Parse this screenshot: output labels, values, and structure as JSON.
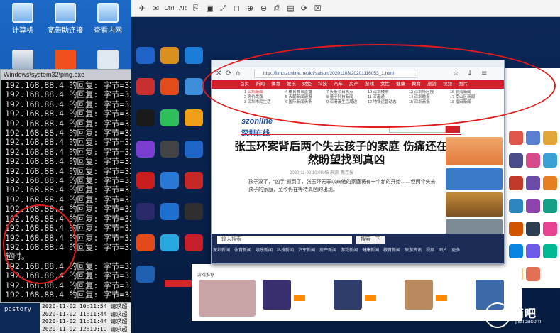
{
  "desktop_left": {
    "icons": [
      {
        "label": "计算机",
        "icon": "computer-icon"
      },
      {
        "label": "宽带助连接",
        "icon": "network-icon"
      },
      {
        "label": "查看内网",
        "icon": "monitor-icon"
      },
      {
        "label": "",
        "icon": "recycle-bin-icon"
      },
      {
        "label": "",
        "icon": "settings-gear-icon"
      },
      {
        "label": "",
        "icon": "document-icon"
      }
    ]
  },
  "cmd": {
    "title": "Windows\\system32\\ping.exe",
    "lines": [
      "192.168.88.4 的回复: 字节=32",
      "192.168.88.4 的回复: 字节=32",
      "192.168.88.4 的回复: 字节=32",
      "192.168.88.4 的回复: 字节=32",
      "192.168.88.4 的回复: 字节=32",
      "192.168.88.4 的回复: 字节=32",
      "192.168.88.4 的回复: 字节=32",
      "192.168.88.4 的回复: 字节=32",
      "192.168.88.4 的回复: 字节=32",
      "192.168.88.4 的回复: 字节=32",
      "192.168.88.4 的回复: 字节=32",
      "192.168.88.4 的回复: 字节=32",
      "192.168.88.4 的回复: 字节=32",
      "192.168.88.4 的回复: 字节=32",
      "192.168.88.4 的回复: 字节=32",
      "192.168.88.4 的回复: 字节=32",
      "192.168.88.4 的回复: 字节=32",
      "192.168.88.4 的回复: 字节=32",
      "超时。",
      "192.168.88.4 的回复: 字节=32",
      "192.168.88.4 的回复: 字节=32",
      "192.168.88.4 的回复: 字节=32",
      "192.168.88.4 的回复: 字节=32"
    ]
  },
  "log": {
    "prompt": "pcstory",
    "lines": [
      "2020-11-02 10:11:54  请求超",
      "2020-11-02 11:11:44  请求超",
      "2020-11-02 11:11:44  请求超",
      "2020-11-02 12:19:19  请求超"
    ]
  },
  "toolbar": {
    "buttons": [
      {
        "glyph": "✈",
        "name": "send-icon"
      },
      {
        "glyph": "✉",
        "name": "mail-icon"
      },
      {
        "glyph": "Ctrl",
        "name": "ctrl-key-button"
      },
      {
        "glyph": "Alt",
        "name": "alt-key-button"
      },
      {
        "glyph": "⎘",
        "name": "copy-icon"
      },
      {
        "glyph": "▣",
        "name": "screen-icon"
      },
      {
        "glyph": "⤢",
        "name": "fullscreen-icon"
      },
      {
        "glyph": "◻",
        "name": "fit-icon"
      },
      {
        "glyph": "⊕",
        "name": "zoom-in-icon"
      },
      {
        "glyph": "⊖",
        "name": "zoom-out-icon"
      },
      {
        "glyph": "⎙",
        "name": "print-icon"
      },
      {
        "glyph": "▤",
        "name": "file-icon"
      },
      {
        "glyph": "⟳",
        "name": "refresh-icon"
      },
      {
        "glyph": "☒",
        "name": "close-session-icon"
      }
    ]
  },
  "browser": {
    "url": "http://film.szonline.net/kit/saisun/20201103/20201116053_1.html",
    "nav": [
      "首页",
      "新闻",
      "体育",
      "娱乐",
      "财经",
      "科技",
      "汽车",
      "房产",
      "游戏",
      "女性",
      "健康",
      "教育",
      "旅游",
      "视频",
      "图片"
    ],
    "link_cols": [
      [
        "1 深圳新闻",
        "2 房价跳涨",
        "3 深圳市民生活"
      ],
      [
        "4 体育赛事直播",
        "5 天朝新闻速报",
        "6 国际新闻头条"
      ],
      [
        "7 头条今日热点",
        "8 量子科技新闻",
        "9 深港澳生活周边"
      ],
      [
        "10 深圳楼市",
        "11 深港通",
        "12 地铁运营动态"
      ],
      [
        "13 深圳特区报",
        "14 深圳晚报",
        "15 深圳商报"
      ],
      [
        "16 前海新闻",
        "17 南山区新闻",
        "18 福田新闻"
      ]
    ],
    "brand": "szonline",
    "brand_sub": "深圳在线",
    "article_title": "张玉环案背后两个失去孩子的家庭 伤痛还在仍然盼望找到真凶",
    "article_meta": "2020-11-02 10:09:45  来源: 新京报",
    "article_body": "孩子没了，“凶手”抓到了，张玉环无罪以来他的家庭将有一个新的开始……但两个失去孩子的家庭，至今仍在等待真凶的出现。",
    "bottom_input_placeholder": "输入搜索",
    "bottom_button": "搜索一下",
    "bottom_links": [
      "深圳新闻",
      "体育新闻",
      "娱乐新闻",
      "科技新闻",
      "汽车新闻",
      "房产新闻",
      "游戏新闻",
      "健康新闻",
      "教育新闻",
      "旅游资讯",
      "视频",
      "图片",
      "更多"
    ]
  },
  "game_panel": {
    "header": "游戏推荐",
    "items": [
      {
        "label": "开始游戏"
      },
      {
        "label": "开始游戏"
      },
      {
        "label": "开始游戏"
      },
      {
        "label": "开始游戏"
      }
    ]
  },
  "watermark": {
    "text": "简吧",
    "sub": "jianbacom"
  },
  "colors": {
    "annotation": "#e21b1b",
    "brand_red": "#d21f2a",
    "desktop_blue": "#1c69c6"
  }
}
